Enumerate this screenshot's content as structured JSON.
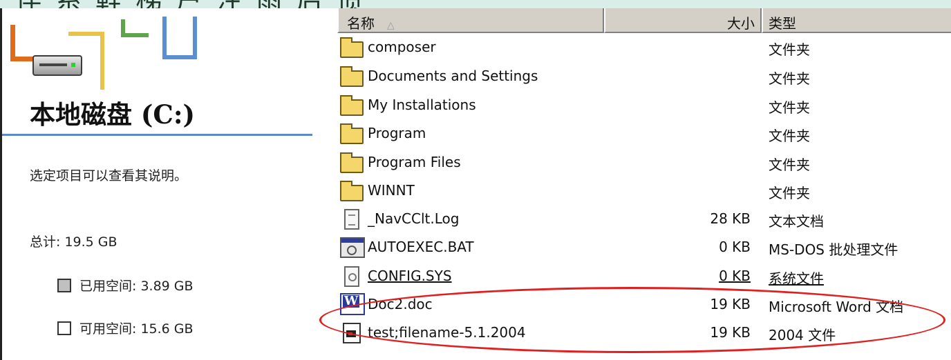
{
  "top_strip_text": "伴 系 鞋 梯 户 注 雨 后 惯",
  "left_pane": {
    "drive_title": "本地磁盘 (C:)",
    "description": "选定项目可以查看其说明。",
    "total_label": "总计: 19.5 GB",
    "used_label": "已用空间: 3.89 GB",
    "free_label": "可用空间: 15.6 GB",
    "used_color": "#c0c0c0",
    "free_color": "#ffffff"
  },
  "list": {
    "columns": {
      "name": "名称",
      "size": "大小",
      "type": "类型"
    },
    "sort_indicator": "△",
    "rows": [
      {
        "icon": "folder-icon",
        "name": "composer",
        "size": "",
        "type": "文件夹"
      },
      {
        "icon": "folder-icon",
        "name": "Documents and Settings",
        "size": "",
        "type": "文件夹"
      },
      {
        "icon": "folder-icon",
        "name": "My Installations",
        "size": "",
        "type": "文件夹"
      },
      {
        "icon": "folder-icon",
        "name": "Program",
        "size": "",
        "type": "文件夹"
      },
      {
        "icon": "folder-icon",
        "name": "Program Files",
        "size": "",
        "type": "文件夹"
      },
      {
        "icon": "folder-icon",
        "name": "WINNT",
        "size": "",
        "type": "文件夹"
      },
      {
        "icon": "text-document-icon",
        "name": "_NavCClt.Log",
        "size": "28 KB",
        "type": "文本文档"
      },
      {
        "icon": "batch-file-icon",
        "name": "AUTOEXEC.BAT",
        "size": "0 KB",
        "type": "MS-DOS 批处理文件"
      },
      {
        "icon": "system-file-icon",
        "name": "CONFIG.SYS",
        "size": "0 KB",
        "type": "系统文件"
      },
      {
        "icon": "word-document-icon",
        "name": "Doc2.doc",
        "size": "19 KB",
        "type": "Microsoft Word 文档"
      },
      {
        "icon": "generic-file-icon",
        "name": "test;filename-5.1.2004",
        "size": "19 KB",
        "type": "2004 文件"
      }
    ]
  },
  "highlight_color": "#e02020"
}
